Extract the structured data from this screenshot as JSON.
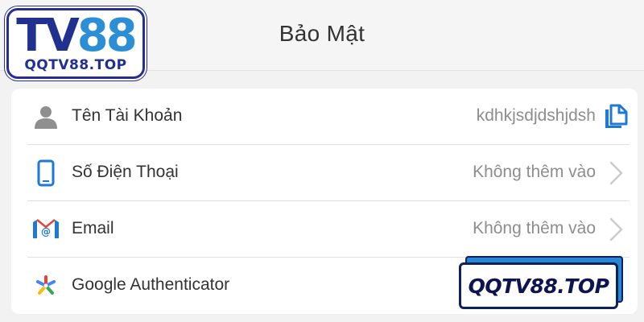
{
  "header": {
    "title": "Bảo Mật",
    "logo": {
      "main_tv": "TV",
      "main_88": "88",
      "sub": "QQTV88.TOP"
    }
  },
  "security_list": {
    "items": [
      {
        "label": "Tên Tài Khoản",
        "value": "kdhkjsdjdshjdsh",
        "icon": "user-icon",
        "action_icon": "copy-icon"
      },
      {
        "label": "Số Điện Thoại",
        "value": "Không thêm vào",
        "icon": "phone-icon",
        "action_icon": "chevron-right-icon"
      },
      {
        "label": "Email",
        "value": "Không thêm vào",
        "icon": "email-icon",
        "action_icon": "chevron-right-icon"
      },
      {
        "label": "Google Authenticator",
        "value": "",
        "icon": "google-authenticator-icon",
        "action_icon": ""
      }
    ]
  },
  "watermark": {
    "text": "QQTV88.TOP"
  },
  "colors": {
    "brand_dark": "#21318f",
    "brand_light": "#2c8fd6",
    "icon_blue": "#1e78d6",
    "icon_gray": "#8f8f8f",
    "value_gray": "#8d8d8d"
  }
}
